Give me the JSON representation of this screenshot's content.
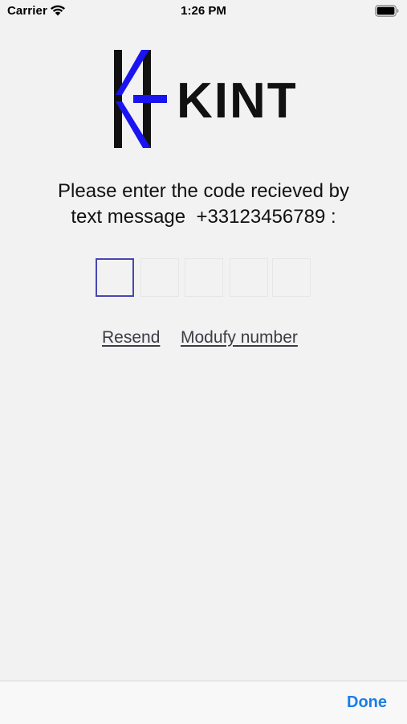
{
  "status_bar": {
    "carrier": "Carrier",
    "time": "1:26 PM",
    "wifi_icon": "wifi-icon",
    "battery_icon": "battery-icon"
  },
  "logo": {
    "text": "KINT",
    "accent_color": "#1a14f0",
    "primary_color": "#111111"
  },
  "prompt": {
    "line1": "Please enter the code recieved by",
    "line2": "text message  +33123456789 :"
  },
  "code": {
    "digits": [
      "",
      "",
      "",
      "",
      ""
    ],
    "active_index": 0,
    "active_border_color": "#4646b4"
  },
  "links": {
    "resend": "Resend",
    "modify_number": "Modufy number"
  },
  "toolbar": {
    "done_label": "Done",
    "done_color": "#1a7ee6"
  }
}
